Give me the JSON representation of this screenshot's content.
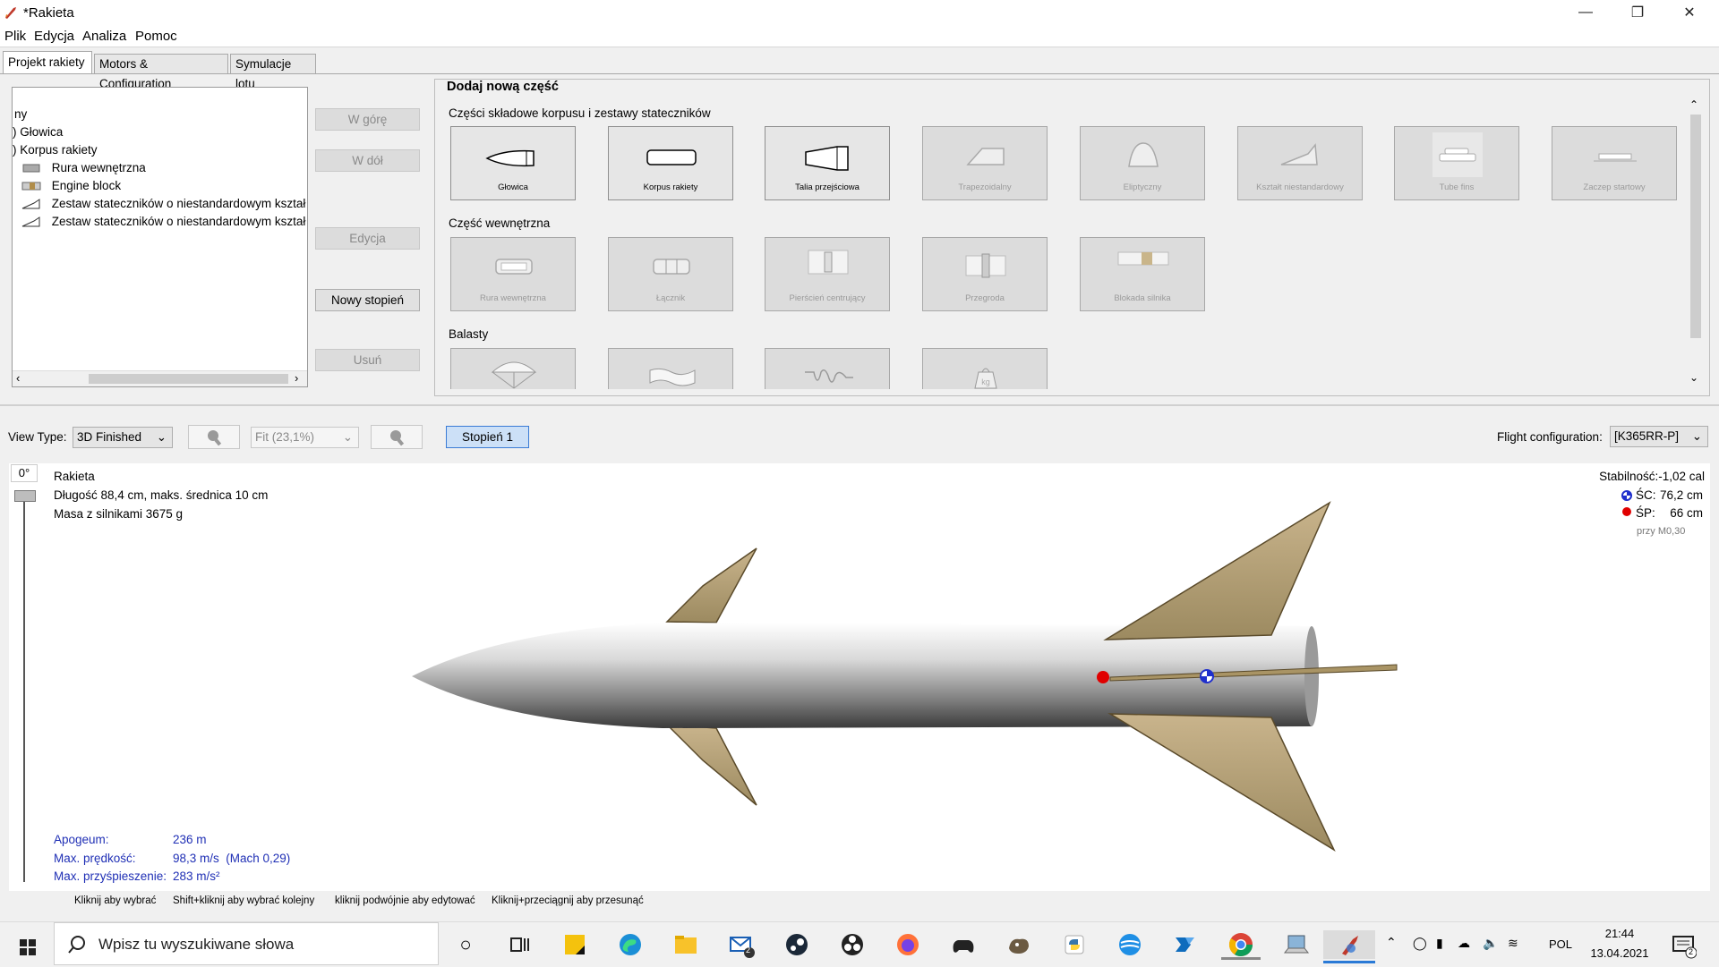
{
  "window": {
    "title": "*Rakieta"
  },
  "menu": {
    "items": [
      "Plik",
      "Edycja",
      "Analiza",
      "Pomoc"
    ]
  },
  "tabs": [
    {
      "label": "Projekt rakiety",
      "active": true
    },
    {
      "label": "Motors & Configuration",
      "active": false
    },
    {
      "label": "Symulacje lotu",
      "active": false
    }
  ],
  "tree": {
    "items": [
      {
        "label": "ny",
        "level": 0
      },
      {
        "label": "Głowica",
        "level": 1
      },
      {
        "label": "Korpus rakiety",
        "level": 1
      },
      {
        "label": "Rura wewnętrzna",
        "level": 2,
        "icon": "inner-tube-icon"
      },
      {
        "label": "Engine block",
        "level": 2,
        "icon": "engine-block-icon"
      },
      {
        "label": "Zestaw stateczników o niestandardowym kształ",
        "level": 2,
        "icon": "freeform-fin-icon"
      },
      {
        "label": "Zestaw stateczników o niestandardowym kształ",
        "level": 2,
        "icon": "freeform-fin-icon"
      }
    ]
  },
  "side_buttons": {
    "up": "W górę",
    "down": "W dół",
    "edit": "Edycja",
    "new_stage": "Nowy stopień",
    "delete": "Usuń"
  },
  "parts_panel": {
    "title": "Dodaj nową część",
    "body_section": "Części składowe korpusu i zestawy stateczników",
    "body_parts": [
      {
        "label": "Głowica",
        "enabled": true,
        "icon": "nose-cone-icon"
      },
      {
        "label": "Korpus rakiety",
        "enabled": true,
        "icon": "body-tube-icon"
      },
      {
        "label": "Talia przejściowa",
        "enabled": true,
        "icon": "transition-icon"
      },
      {
        "label": "Trapezoidalny",
        "enabled": false,
        "icon": "trapezoid-fin-icon"
      },
      {
        "label": "Eliptyczny",
        "enabled": false,
        "icon": "elliptical-fin-icon"
      },
      {
        "label": "Kształt niestandardowy",
        "enabled": false,
        "icon": "freeform-fin-icon"
      },
      {
        "label": "Tube fins",
        "enabled": false,
        "icon": "tube-fins-icon"
      },
      {
        "label": "Zaczep startowy",
        "enabled": false,
        "icon": "launch-lug-icon"
      }
    ],
    "inner_section": "Część wewnętrzna",
    "inner_parts": [
      {
        "label": "Rura wewnętrzna",
        "enabled": false,
        "icon": "inner-tube-icon"
      },
      {
        "label": "Łącznik",
        "enabled": false,
        "icon": "coupler-icon"
      },
      {
        "label": "Pierścień centrujący",
        "enabled": false,
        "icon": "centering-ring-icon"
      },
      {
        "label": "Przegroda",
        "enabled": false,
        "icon": "bulkhead-icon"
      },
      {
        "label": "Blokada silnika",
        "enabled": false,
        "icon": "engine-block-icon"
      }
    ],
    "mass_section": "Balasty",
    "mass_parts": [
      {
        "label": "",
        "icon": "parachute-icon"
      },
      {
        "label": "",
        "icon": "streamer-icon"
      },
      {
        "label": "",
        "icon": "shock-cord-icon"
      },
      {
        "label": "",
        "icon": "mass-component-icon"
      }
    ]
  },
  "view_toolbar": {
    "view_type_label": "View Type:",
    "view_type_value": "3D Finished",
    "zoom_value": "Fit (23,1%)",
    "stage_button": "Stopień 1",
    "flight_config_label": "Flight configuration:",
    "flight_config_value": "[K365RR-P]",
    "rotation": "0°"
  },
  "rocket_info": {
    "name": "Rakieta",
    "length_line": "Długość 88,4 cm, maks. średnica 10 cm",
    "mass_line": "Masa z silnikami 3675 g"
  },
  "stability": {
    "title": "Stabilność:-1,02 cal",
    "cg_label": "ŚC:",
    "cg_value": "76,2 cm",
    "cp_label": "ŚP:",
    "cp_value": "66 cm",
    "mach": "przy M0,30",
    "cg_color": "#1f2fcc",
    "cp_color": "#e00000"
  },
  "flight_results": [
    {
      "label": "Apogeum:",
      "value": "236 m"
    },
    {
      "label": "Max. prędkość:",
      "value": "98,3 m/s  (Mach 0,29)"
    },
    {
      "label": "Max. przyśpieszenie:",
      "value": "283 m/s²"
    }
  ],
  "hints": [
    "Kliknij aby wybrać",
    "Shift+kliknij aby wybrać kolejny",
    "kliknij podwójnie aby edytować",
    "Kliknij+przeciągnij aby przesunąć"
  ],
  "taskbar": {
    "search_placeholder": "Wpisz tu wyszukiwane słowa",
    "language": "POL",
    "time": "21:44",
    "date": "13.04.2021",
    "mail_badge": "2",
    "notification_badge": "2"
  }
}
